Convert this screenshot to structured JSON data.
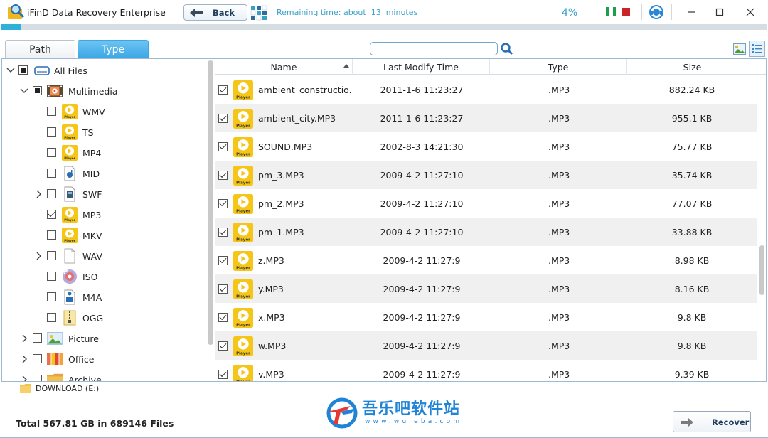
{
  "app": {
    "title": "iFinD Data Recovery Enterprise",
    "back_label": "Back",
    "remaining_prefix": "Remaining time: about",
    "remaining_value": "13",
    "remaining_unit": "minutes",
    "progress_percent_text": "4%",
    "progress_fraction": 0.025,
    "accent_color": "#2eb0d8"
  },
  "tabs": [
    {
      "label": "Path",
      "active": false
    },
    {
      "label": "Type",
      "active": true
    }
  ],
  "search": {
    "value": "",
    "placeholder": ""
  },
  "tree": {
    "root": {
      "label": "All Files"
    },
    "multimedia": {
      "label": "Multimedia"
    },
    "items": [
      {
        "label": "WMV",
        "icon": "player-icon",
        "checked": false
      },
      {
        "label": "TS",
        "icon": "player-icon",
        "checked": false
      },
      {
        "label": "MP4",
        "icon": "player-icon",
        "checked": false
      },
      {
        "label": "MID",
        "icon": "midi-file-icon",
        "checked": false
      },
      {
        "label": "SWF",
        "icon": "swf-file-icon",
        "checked": false
      },
      {
        "label": "MP3",
        "icon": "player-icon",
        "checked": true
      },
      {
        "label": "MKV",
        "icon": "player-icon",
        "checked": false
      },
      {
        "label": "WAV",
        "icon": "blank-file-icon",
        "checked": false
      },
      {
        "label": "ISO",
        "icon": "disc-icon",
        "checked": false
      },
      {
        "label": "M4A",
        "icon": "m4a-file-icon",
        "checked": false
      },
      {
        "label": "OGG",
        "icon": "archive-file-icon",
        "checked": false
      }
    ],
    "categories": [
      {
        "label": "Picture",
        "icon": "picture-icon"
      },
      {
        "label": "Office",
        "icon": "office-icon"
      },
      {
        "label": "Archive",
        "icon": "archive-folder-icon"
      }
    ]
  },
  "table": {
    "columns": [
      "Name",
      "Last Modify Time",
      "Type",
      "Size"
    ],
    "rows": [
      {
        "name": "ambient_constructio...",
        "time": "2011-1-6 11:23:27",
        "type": ".MP3",
        "size": "882.24 KB"
      },
      {
        "name": "ambient_city.MP3",
        "time": "2011-1-6 11:23:27",
        "type": ".MP3",
        "size": "955.1 KB"
      },
      {
        "name": "SOUND.MP3",
        "time": "2002-8-3 14:21:30",
        "type": ".MP3",
        "size": "75.77 KB"
      },
      {
        "name": "pm_3.MP3",
        "time": "2009-4-2 11:27:10",
        "type": ".MP3",
        "size": "35.74 KB"
      },
      {
        "name": "pm_2.MP3",
        "time": "2009-4-2 11:27:10",
        "type": ".MP3",
        "size": "77.07 KB"
      },
      {
        "name": "pm_1.MP3",
        "time": "2009-4-2 11:27:10",
        "type": ".MP3",
        "size": "33.88 KB"
      },
      {
        "name": "z.MP3",
        "time": "2009-4-2 11:27:9",
        "type": ".MP3",
        "size": "8.98 KB"
      },
      {
        "name": "y.MP3",
        "time": "2009-4-2 11:27:9",
        "type": ".MP3",
        "size": "8.16 KB"
      },
      {
        "name": "x.MP3",
        "time": "2009-4-2 11:27:9",
        "type": ".MP3",
        "size": "9.8 KB"
      },
      {
        "name": "w.MP3",
        "time": "2009-4-2 11:27:9",
        "type": ".MP3",
        "size": "9.8 KB"
      },
      {
        "name": "v.MP3",
        "time": "2009-4-2 11:27:9",
        "type": ".MP3",
        "size": "9.39 KB"
      }
    ],
    "file_icon_label": "Player"
  },
  "status": {
    "drive_label": "DOWNLOAD (E:)",
    "total": "Total 567.81 GB in 689146 Files",
    "recover_label": "Recover"
  },
  "watermark": {
    "cn": "吾乐吧软件站",
    "en": "www.wuleba.com"
  }
}
